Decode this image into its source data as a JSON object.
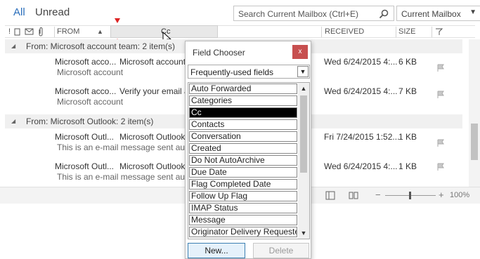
{
  "tabs": {
    "all": "All",
    "unread": "Unread"
  },
  "search": {
    "placeholder": "Search Current Mailbox (Ctrl+E)",
    "scope": "Current Mailbox"
  },
  "columns": {
    "from": "FROM",
    "received": "RECEIVED",
    "size": "SIZE",
    "dragging": "Cc"
  },
  "groups": [
    {
      "label": "From: Microsoft account team: 2 item(s)",
      "messages": [
        {
          "from": "Microsoft acco...",
          "subject": "Microsoft account",
          "preview": "Microsoft account",
          "received": "Wed 6/24/2015 4:...",
          "size": "6 KB"
        },
        {
          "from": "Microsoft acco...",
          "subject": "Verify your email a",
          "preview": "Microsoft account",
          "received": "Wed 6/24/2015 4:...",
          "size": "7 KB"
        }
      ]
    },
    {
      "label": "From: Microsoft Outlook: 2 item(s)",
      "messages": [
        {
          "from": "Microsoft Outl...",
          "subject": "Microsoft Outlook",
          "preview": "This is an e-mail message sent autor",
          "received": "Fri 7/24/2015 1:52...",
          "size": "1 KB"
        },
        {
          "from": "Microsoft Outl...",
          "subject": "Microsoft Outlook",
          "preview": "This is an e-mail message sent autor",
          "received": "Wed 6/24/2015 4:...",
          "size": "1 KB"
        }
      ]
    }
  ],
  "status": {
    "zoom": "100%"
  },
  "dialog": {
    "title": "Field Chooser",
    "close": "x",
    "category": "Frequently-used fields",
    "fields": [
      "Auto Forwarded",
      "Categories",
      "Cc",
      "Contacts",
      "Conversation",
      "Created",
      "Do Not AutoArchive",
      "Due Date",
      "Flag Completed Date",
      "Follow Up Flag",
      "IMAP Status",
      "Message",
      "Originator Delivery Requested"
    ],
    "selected_field": "Cc",
    "new_button": "New...",
    "delete_button": "Delete"
  }
}
